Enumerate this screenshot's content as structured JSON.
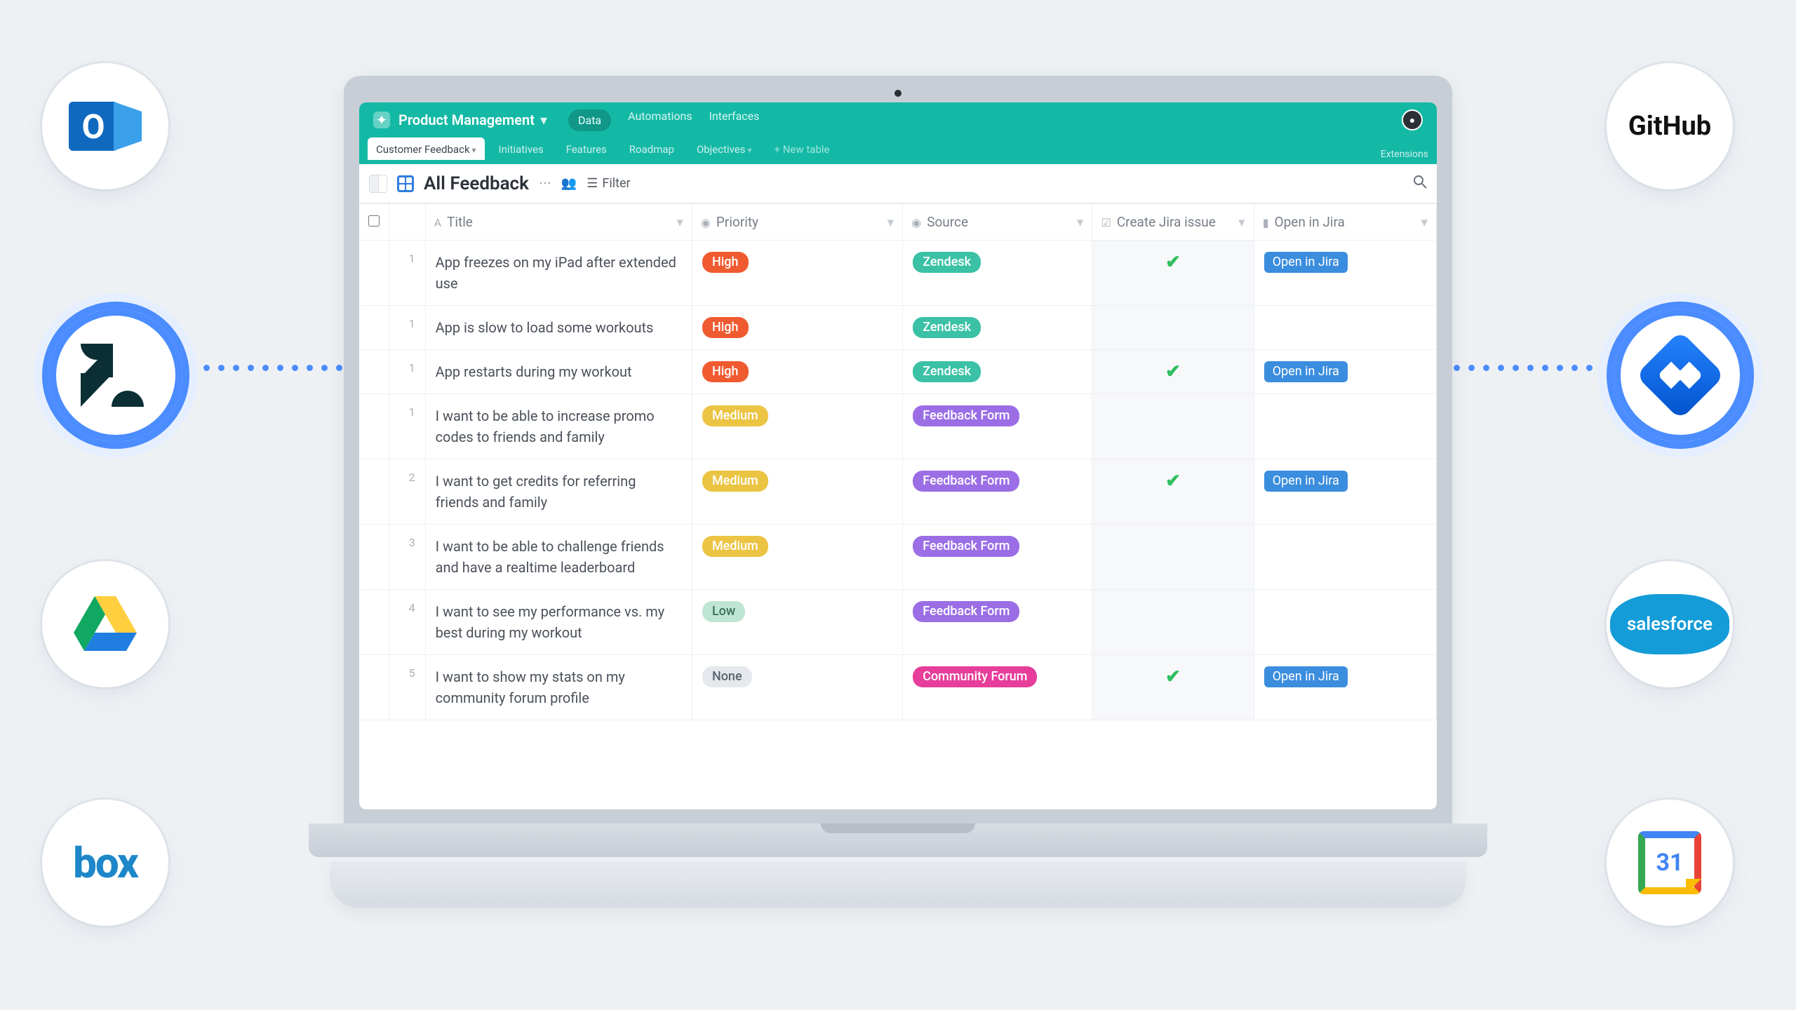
{
  "workspace": {
    "name": "Product Management"
  },
  "top_tabs": {
    "data": "Data",
    "automations": "Automations",
    "interfaces": "Interfaces"
  },
  "extensions_label": "Extensions",
  "sub_tabs": {
    "customer_feedback": "Customer Feedback",
    "initiatives": "Initiatives",
    "features": "Features",
    "roadmap": "Roadmap",
    "objectives": "Objectives",
    "new_table": "+ New table"
  },
  "toolbar": {
    "view_name": "All Feedback",
    "filter_label": "Filter"
  },
  "columns": {
    "title": "Title",
    "priority": "Priority",
    "source": "Source",
    "create_jira": "Create Jira issue",
    "open_jira": "Open in Jira"
  },
  "rows": [
    {
      "num": "1",
      "title": "App freezes on my iPad after extended use",
      "priority": "High",
      "priority_class": "pill-high",
      "source": "Zendesk",
      "source_class": "pill-zendesk",
      "created": true,
      "open": "Open in Jira"
    },
    {
      "num": "1",
      "title": "App is slow to load some workouts",
      "priority": "High",
      "priority_class": "pill-high",
      "source": "Zendesk",
      "source_class": "pill-zendesk",
      "created": false,
      "open": ""
    },
    {
      "num": "1",
      "title": "App restarts during my workout",
      "priority": "High",
      "priority_class": "pill-high",
      "source": "Zendesk",
      "source_class": "pill-zendesk",
      "created": true,
      "open": "Open in Jira"
    },
    {
      "num": "1",
      "title": "I want to be able to increase promo codes to friends and family",
      "priority": "Medium",
      "priority_class": "pill-medium",
      "source": "Feedback Form",
      "source_class": "pill-feedbackform",
      "created": false,
      "open": ""
    },
    {
      "num": "2",
      "title": "I want to get credits for referring friends and family",
      "priority": "Medium",
      "priority_class": "pill-medium",
      "source": "Feedback Form",
      "source_class": "pill-feedbackform",
      "created": true,
      "open": "Open in Jira"
    },
    {
      "num": "3",
      "title": "I want to be able to challenge friends and have a realtime leaderboard",
      "priority": "Medium",
      "priority_class": "pill-medium",
      "source": "Feedback Form",
      "source_class": "pill-feedbackform",
      "created": false,
      "open": ""
    },
    {
      "num": "4",
      "title": "I want to see my performance vs. my best during my workout",
      "priority": "Low",
      "priority_class": "pill-low",
      "source": "Feedback Form",
      "source_class": "pill-feedbackform",
      "created": false,
      "open": ""
    },
    {
      "num": "5",
      "title": "I want to show my stats on my community forum profile",
      "priority": "None",
      "priority_class": "pill-none",
      "source": "Community Forum",
      "source_class": "pill-community",
      "created": true,
      "open": "Open in Jira"
    }
  ],
  "integrations": {
    "github": "GitHub",
    "salesforce": "salesforce",
    "box": "box",
    "gcal_day": "31"
  }
}
